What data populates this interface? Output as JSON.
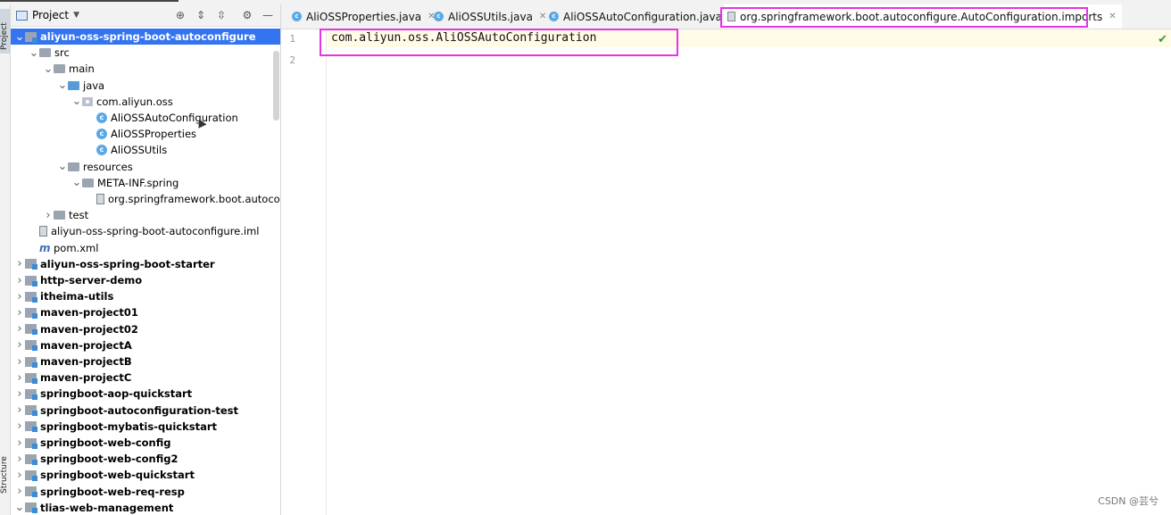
{
  "side_tabs": {
    "project": "Project",
    "structure": "Structure"
  },
  "panel": {
    "title": "Project"
  },
  "tree": [
    {
      "label": "aliyun-oss-spring-boot-autoconfigure",
      "depth": 0,
      "arrow": "v",
      "icon": "module-icon",
      "bold": true,
      "selected": true
    },
    {
      "label": "src",
      "depth": 1,
      "arrow": "v",
      "icon": "folder-icon"
    },
    {
      "label": "main",
      "depth": 2,
      "arrow": "v",
      "icon": "folder-icon"
    },
    {
      "label": "java",
      "depth": 3,
      "arrow": "v",
      "icon": "source-folder-icon"
    },
    {
      "label": "com.aliyun.oss",
      "depth": 4,
      "arrow": "v",
      "icon": "package-icon"
    },
    {
      "label": "AliOSSAutoConfiguration",
      "depth": 5,
      "arrow": "",
      "icon": "class-icon"
    },
    {
      "label": "AliOSSProperties",
      "depth": 5,
      "arrow": "",
      "icon": "class-icon"
    },
    {
      "label": "AliOSSUtils",
      "depth": 5,
      "arrow": "",
      "icon": "class-icon"
    },
    {
      "label": "resources",
      "depth": 3,
      "arrow": "v",
      "icon": "resources-folder-icon"
    },
    {
      "label": "META-INF.spring",
      "depth": 4,
      "arrow": "v",
      "icon": "folder-icon"
    },
    {
      "label": "org.springframework.boot.autoconfigure.AutoConfiguration.imports",
      "depth": 5,
      "arrow": "",
      "icon": "file-icon"
    },
    {
      "label": "test",
      "depth": 2,
      "arrow": ">",
      "icon": "folder-icon"
    },
    {
      "label": "aliyun-oss-spring-boot-autoconfigure.iml",
      "depth": 1,
      "arrow": "",
      "icon": "iml-file-icon"
    },
    {
      "label": "pom.xml",
      "depth": 1,
      "arrow": "",
      "icon": "maven-icon"
    },
    {
      "label": "aliyun-oss-spring-boot-starter",
      "depth": 0,
      "arrow": ">",
      "icon": "module-icon",
      "bold": true
    },
    {
      "label": "http-server-demo",
      "depth": 0,
      "arrow": ">",
      "icon": "module-icon",
      "bold": true
    },
    {
      "label": "itheima-utils",
      "depth": 0,
      "arrow": ">",
      "icon": "module-icon",
      "bold": true
    },
    {
      "label": "maven-project01",
      "depth": 0,
      "arrow": ">",
      "icon": "module-icon",
      "bold": true
    },
    {
      "label": "maven-project02",
      "depth": 0,
      "arrow": ">",
      "icon": "module-icon",
      "bold": true
    },
    {
      "label": "maven-projectA",
      "depth": 0,
      "arrow": ">",
      "icon": "module-icon",
      "bold": true
    },
    {
      "label": "maven-projectB",
      "depth": 0,
      "arrow": ">",
      "icon": "module-icon",
      "bold": true
    },
    {
      "label": "maven-projectC",
      "depth": 0,
      "arrow": ">",
      "icon": "module-icon",
      "bold": true
    },
    {
      "label": "springboot-aop-quickstart",
      "depth": 0,
      "arrow": ">",
      "icon": "module-icon",
      "bold": true
    },
    {
      "label": "springboot-autoconfiguration-test",
      "depth": 0,
      "arrow": ">",
      "icon": "module-icon",
      "bold": true
    },
    {
      "label": "springboot-mybatis-quickstart",
      "depth": 0,
      "arrow": ">",
      "icon": "module-icon",
      "bold": true
    },
    {
      "label": "springboot-web-config",
      "depth": 0,
      "arrow": ">",
      "icon": "module-icon",
      "bold": true
    },
    {
      "label": "springboot-web-config2",
      "depth": 0,
      "arrow": ">",
      "icon": "module-icon",
      "bold": true
    },
    {
      "label": "springboot-web-quickstart",
      "depth": 0,
      "arrow": ">",
      "icon": "module-icon",
      "bold": true
    },
    {
      "label": "springboot-web-req-resp",
      "depth": 0,
      "arrow": ">",
      "icon": "module-icon",
      "bold": true
    },
    {
      "label": "tlias-web-management",
      "depth": 0,
      "arrow": "v",
      "icon": "module-icon",
      "bold": true
    }
  ],
  "tabs": [
    {
      "label": "AliOSSProperties.java",
      "icon": "class-icon"
    },
    {
      "label": "AliOSSUtils.java",
      "icon": "class-icon"
    },
    {
      "label": "AliOSSAutoConfiguration.java",
      "icon": "class-icon"
    },
    {
      "label": "org.springframework.boot.autoconfigure.AutoConfiguration.imports",
      "icon": "file-icon",
      "active": true
    }
  ],
  "editor": {
    "lines": [
      {
        "num": "1",
        "text": "com.aliyun.oss.AliOSSAutoConfiguration"
      },
      {
        "num": "2",
        "text": ""
      }
    ]
  },
  "watermark": "CSDN @芸兮",
  "colors": {
    "selection": "#3574f0",
    "highlight": "#e534e5"
  }
}
